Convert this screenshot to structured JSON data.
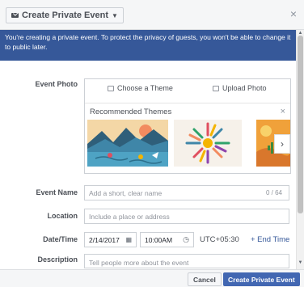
{
  "header": {
    "type_button_label": "Create Private Event",
    "close_icon": "close-icon"
  },
  "banner": {
    "text": "You're creating a private event. To protect the privacy of guests, you won't be able to change it to public later."
  },
  "form": {
    "event_photo": {
      "label": "Event Photo",
      "choose_theme": "Choose a Theme",
      "upload_photo": "Upload Photo",
      "themes_title": "Recommended Themes",
      "next_icon": "chevron-right-icon"
    },
    "event_name": {
      "label": "Event Name",
      "placeholder": "Add a short, clear name",
      "counter": "0 / 64"
    },
    "location": {
      "label": "Location",
      "placeholder": "Include a place or address"
    },
    "datetime": {
      "label": "Date/Time",
      "date": "2/14/2017",
      "time": "10:00AM",
      "timezone": "UTC+05:30",
      "end_time_link": "+ End Time"
    },
    "description": {
      "label": "Description",
      "placeholder": "Tell people more about the event"
    }
  },
  "footer": {
    "cancel_label": "Cancel",
    "create_label": "Create Private Event"
  },
  "colors": {
    "banner_bg": "#365899",
    "primary_button": "#4267b2",
    "link": "#365899"
  }
}
